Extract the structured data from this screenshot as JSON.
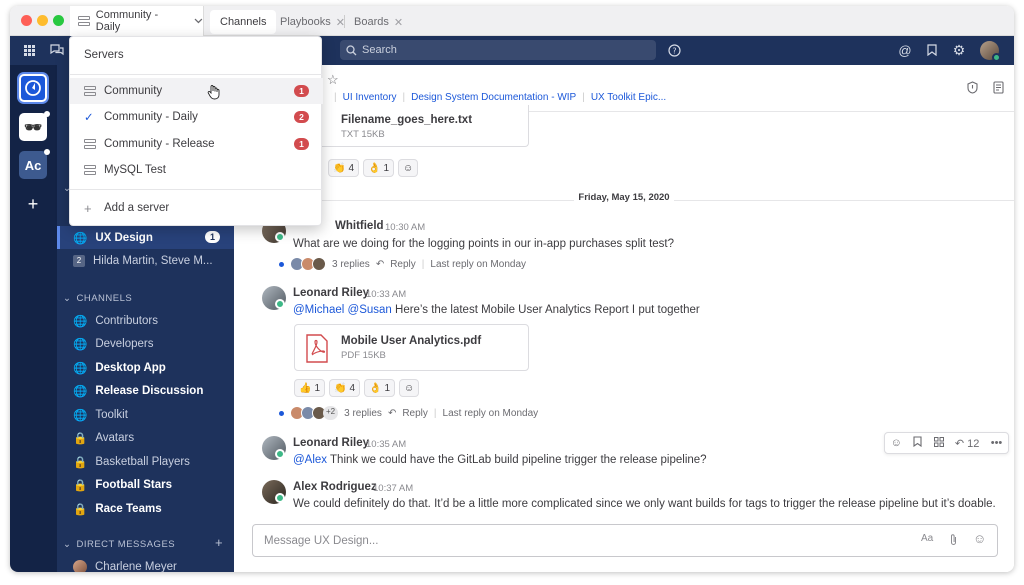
{
  "titlebar": {
    "server_tab_label": "Community - Daily",
    "tabs": [
      {
        "label": "Channels",
        "active": true
      },
      {
        "label": "Playbooks",
        "active": false
      },
      {
        "label": "Boards",
        "active": false
      }
    ]
  },
  "topbar": {
    "search_placeholder": "Search"
  },
  "teams": [
    {
      "label": "",
      "icon": "mattermost-logo-icon"
    },
    {
      "label": "",
      "icon": "incognito-icon"
    },
    {
      "label": "Ac"
    },
    {
      "label": "+"
    }
  ],
  "sidebar": {
    "ux_design": {
      "label": "UX Design",
      "badge": "1"
    },
    "dm_group": {
      "num": "2",
      "label": "Hilda Martin, Steve M..."
    },
    "channels_header": "CHANNELS",
    "channels": [
      {
        "label": "Contributors",
        "icon": "globe",
        "bold": false
      },
      {
        "label": "Developers",
        "icon": "globe",
        "bold": false
      },
      {
        "label": "Desktop App",
        "icon": "globe",
        "bold": true
      },
      {
        "label": "Release Discussion",
        "icon": "globe",
        "bold": true
      },
      {
        "label": "Toolkit",
        "icon": "globe",
        "bold": false
      },
      {
        "label": "Avatars",
        "icon": "lock",
        "bold": false
      },
      {
        "label": "Basketball Players",
        "icon": "lock",
        "bold": false
      },
      {
        "label": "Football Stars",
        "icon": "lock",
        "bold": true
      },
      {
        "label": "Race Teams",
        "icon": "lock",
        "bold": true
      }
    ],
    "dm_header": "DIRECT MESSAGES",
    "dm_first": "Charlene Meyer"
  },
  "channel_header": {
    "bookmarks": [
      "UI Inventory",
      "Design System Documentation - WIP",
      "UX Toolkit Epic..."
    ]
  },
  "posts": {
    "file1": {
      "name": "Filename_goes_here.txt",
      "meta": "TXT 15KB"
    },
    "reactions1": [
      {
        "emoji": "👏",
        "count": "4"
      },
      {
        "emoji": "👌",
        "count": "1"
      }
    ],
    "date_separator": "Friday, May 15, 2020",
    "p1": {
      "author": "Whitfield",
      "time": "10:30 AM",
      "text": "What are we doing for the logging points in our in-app purchases split test?",
      "replies": "3 replies",
      "reply": "Reply",
      "last_reply": "Last reply on Monday"
    },
    "p2": {
      "author": "Leonard Riley",
      "time": "10:33 AM",
      "mention1": "@Michael",
      "mention2": "@Susan",
      "text": " Here’s the latest Mobile User Analytics Report I put together",
      "file_name": "Mobile User Analytics.pdf",
      "file_meta": "PDF 15KB",
      "replies": "3 replies",
      "reply": "Reply",
      "last_reply": "Last reply on Monday",
      "plus": "+2"
    },
    "reactions2": [
      {
        "emoji": "👍",
        "count": "1"
      },
      {
        "emoji": "👏",
        "count": "4"
      },
      {
        "emoji": "👌",
        "count": "1"
      }
    ],
    "p3": {
      "author": "Leonard Riley",
      "time": "10:35 AM",
      "mention": "@Alex",
      "text": " Think we could have the GitLab build pipeline trigger the release pipeline?",
      "reply_count": "12"
    },
    "p4": {
      "author": "Alex Rodriguez",
      "time": "10:37 AM",
      "text": "We could definitely do that. It’d be a little more complicated since we only want builds for tags to trigger the release pipeline but it’s doable."
    }
  },
  "composer": {
    "placeholder": "Message UX Design...",
    "format_label": "Aa"
  },
  "dropdown": {
    "title": "Servers",
    "servers": [
      {
        "label": "Community",
        "badge": "1",
        "selected": false,
        "hover": true
      },
      {
        "label": "Community - Daily",
        "badge": "2",
        "selected": true,
        "hover": false
      },
      {
        "label": "Community - Release",
        "badge": "1",
        "selected": false,
        "hover": false
      },
      {
        "label": "MySQL Test",
        "badge": "",
        "selected": false,
        "hover": false
      }
    ],
    "add_server": "Add a server"
  },
  "colors": {
    "sidebar_bg": "#1e325c",
    "team_bg": "#132346",
    "link": "#1c58d9",
    "badge_red": "#d24b4e",
    "online": "#3db887"
  }
}
